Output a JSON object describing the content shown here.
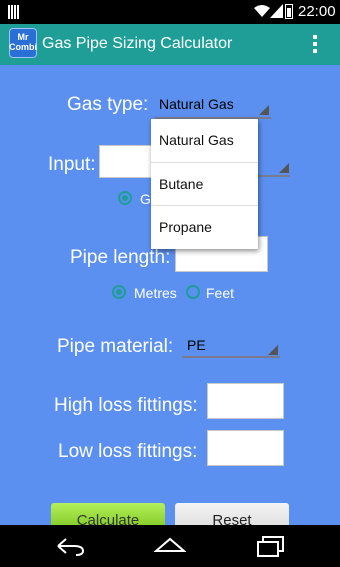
{
  "status": {
    "time": "22:00"
  },
  "app": {
    "logo_line1": "Mr",
    "logo_line2": "Combi",
    "title": "Gas Pipe Sizing Calculator"
  },
  "form": {
    "gas_type_label": "Gas type:",
    "gas_type_value": "Natural Gas",
    "input_label": "Input:",
    "input_value": "",
    "input_radio_label": "G",
    "pipe_length_label": "Pipe length:",
    "pipe_length_value": "",
    "unit_metres": "Metres",
    "unit_feet": "Feet",
    "selected_unit": "Metres",
    "pipe_material_label": "Pipe material:",
    "pipe_material_value": "PE",
    "high_loss_label": "High loss fittings:",
    "high_loss_value": "",
    "low_loss_label": "Low loss fittings:",
    "low_loss_value": ""
  },
  "dropdown": {
    "options": [
      "Natural Gas",
      "Butane",
      "Propane"
    ]
  },
  "buttons": {
    "calculate": "Calculate",
    "reset": "Reset"
  },
  "colors": {
    "background": "#5b90f0",
    "action_bar": "#1e9e97",
    "calculate": "#8fd62a"
  }
}
